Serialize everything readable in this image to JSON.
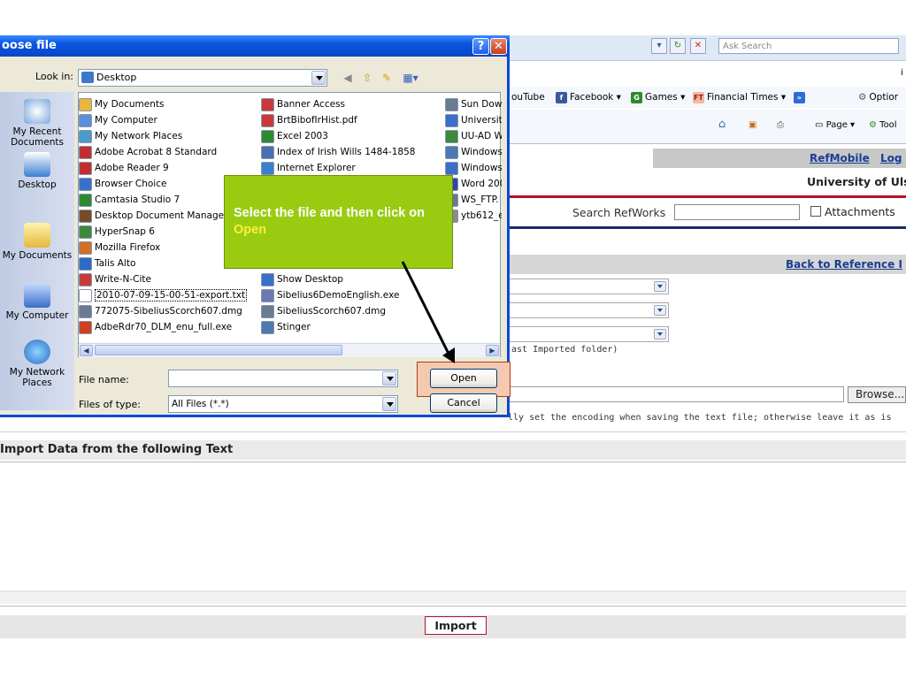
{
  "dialog": {
    "title": "oose file",
    "help_label": "?",
    "close_label": "✕",
    "look_in_label": "Look in:",
    "look_in_value": "Desktop",
    "places": [
      "My Recent Documents",
      "Desktop",
      "My Documents",
      "My Computer",
      "My Network Places"
    ],
    "files_col1": [
      "My Documents",
      "My Computer",
      "My Network Places",
      "Adobe Acrobat 8 Standard",
      "Adobe Reader 9",
      "Browser Choice",
      "Camtasia Studio 7",
      "Desktop Document Manager",
      "HyperSnap 6",
      "Mozilla Firefox",
      "Talis Alto",
      "Write-N-Cite",
      "2010-07-09-15-00-51-export.txt",
      "772075-SibeliusScorch607.dmg",
      "AdbeRdr70_DLM_enu_full.exe"
    ],
    "files_col2": [
      "Banner Access",
      "BrtBibofIrHist.pdf",
      "Excel 2003",
      "Index of Irish Wills 1484-1858",
      "Internet Explorer",
      "Show Desktop",
      "Sibelius6DemoEnglish.exe",
      "SibeliusScorch607.dmg",
      "Stinger"
    ],
    "files_col3": [
      "Sun Down",
      "University",
      "UU-AD W",
      "Windows",
      "Windows",
      "Word 200",
      "WS_FTP.",
      "ytb612_e"
    ],
    "file_name_label": "File name:",
    "file_name_value": "",
    "files_of_type_label": "Files of type:",
    "files_of_type_value": "All Files (*.*)",
    "open_label": "Open",
    "cancel_label": "Cancel"
  },
  "callout": {
    "text_before": "Select the file and then click on ",
    "text_highlight": "Open"
  },
  "browser": {
    "search_placeholder": "Ask Search",
    "fav_youtube": "ouTube",
    "fav_facebook": "Facebook ▾",
    "fav_games": "Games ▾",
    "fav_ft": "Financial Times ▾",
    "fav_more": "»",
    "fav_options": "Optior",
    "cmd_page": "Page ▾",
    "cmd_tools": "Tool",
    "extra_char": "i"
  },
  "page": {
    "refmobile": "RefMobile",
    "log": "Log",
    "university": "University of Uls",
    "search_label": "Search RefWorks",
    "attachments": "Attachments",
    "back_link": "Back to Reference I",
    "last_imported": "ast Imported folder)",
    "browse": "Browse...",
    "encoding_note": "lly set the encoding when saving the text file; otherwise leave it as is",
    "section_title": "Import Data from the following Text",
    "import": "Import"
  }
}
